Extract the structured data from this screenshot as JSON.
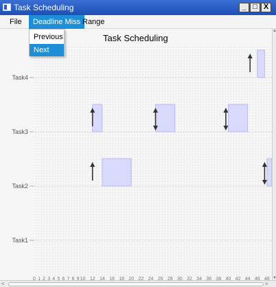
{
  "window": {
    "title": "Task Scheduling",
    "minimize_glyph": "_",
    "maximize_glyph": "□",
    "close_glyph": "X"
  },
  "menubar": {
    "file": "File",
    "deadline_miss": "Deadline Miss",
    "range": "Range"
  },
  "deadline_menu": {
    "previous": "Previous",
    "next": "Next"
  },
  "chart_data": {
    "type": "gantt",
    "title": "Task Scheduling",
    "tasks": [
      "Task1",
      "Task2",
      "Task3",
      "Task4"
    ],
    "x_ticks": [
      0,
      1,
      2,
      3,
      4,
      5,
      6,
      7,
      8,
      9,
      10,
      12,
      14,
      16,
      18,
      20,
      22,
      24,
      26,
      28,
      30,
      32,
      34,
      36,
      38,
      40,
      42,
      44,
      46,
      48
    ],
    "xlim": [
      0,
      49
    ],
    "grid": true,
    "bars": [
      {
        "task": "Task4",
        "start": 46,
        "end": 47.5
      },
      {
        "task": "Task3",
        "start": 12,
        "end": 14
      },
      {
        "task": "Task3",
        "start": 25,
        "end": 29
      },
      {
        "task": "Task3",
        "start": 40,
        "end": 44
      },
      {
        "task": "Task2",
        "start": 14,
        "end": 20
      },
      {
        "task": "Task2",
        "start": 48,
        "end": 50
      }
    ],
    "markers": [
      {
        "task": "Task4",
        "time": 44.5,
        "kind": "release"
      },
      {
        "task": "Task3",
        "time": 12,
        "kind": "release"
      },
      {
        "task": "Task3",
        "time": 25,
        "kind": "release-deadline"
      },
      {
        "task": "Task3",
        "time": 39.5,
        "kind": "release-deadline"
      },
      {
        "task": "Task2",
        "time": 12,
        "kind": "release"
      },
      {
        "task": "Task2",
        "time": 47.5,
        "kind": "release-deadline"
      }
    ],
    "colors": {
      "bar_fill": "#d9d9fb",
      "bar_stroke": "#b9b9ef",
      "arrow": "#333333",
      "grid": "#d0d0d0"
    }
  }
}
